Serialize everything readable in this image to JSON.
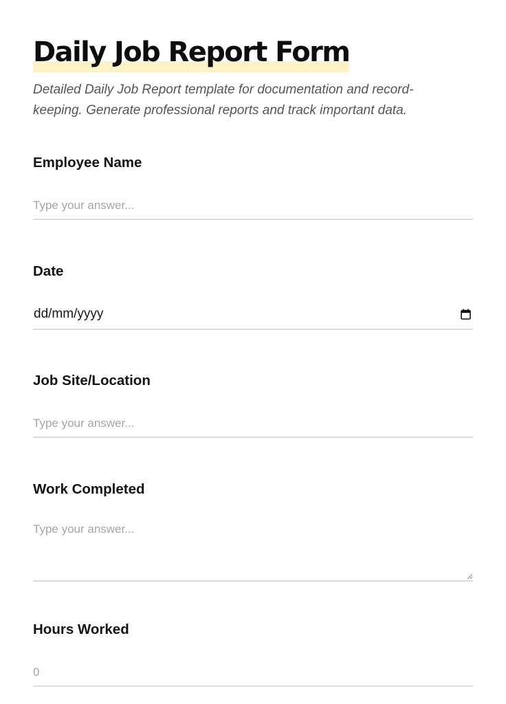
{
  "form": {
    "title": "Daily Job Report Form",
    "description": "Detailed Daily Job Report template for documentation and record-keeping. Generate professional reports and track important data.",
    "accent_highlight_color": "#fdf2c8",
    "fields": {
      "employee_name": {
        "label": "Employee Name",
        "placeholder": "Type your answer...",
        "value": ""
      },
      "date": {
        "label": "Date",
        "value": "dd/mm/yyyy",
        "icon": "calendar-icon"
      },
      "job_site": {
        "label": "Job Site/Location",
        "placeholder": "Type your answer...",
        "value": ""
      },
      "work_completed": {
        "label": "Work Completed",
        "placeholder": "Type your answer...",
        "value": ""
      },
      "hours_worked": {
        "label": "Hours Worked",
        "placeholder": "0",
        "value": ""
      }
    }
  }
}
